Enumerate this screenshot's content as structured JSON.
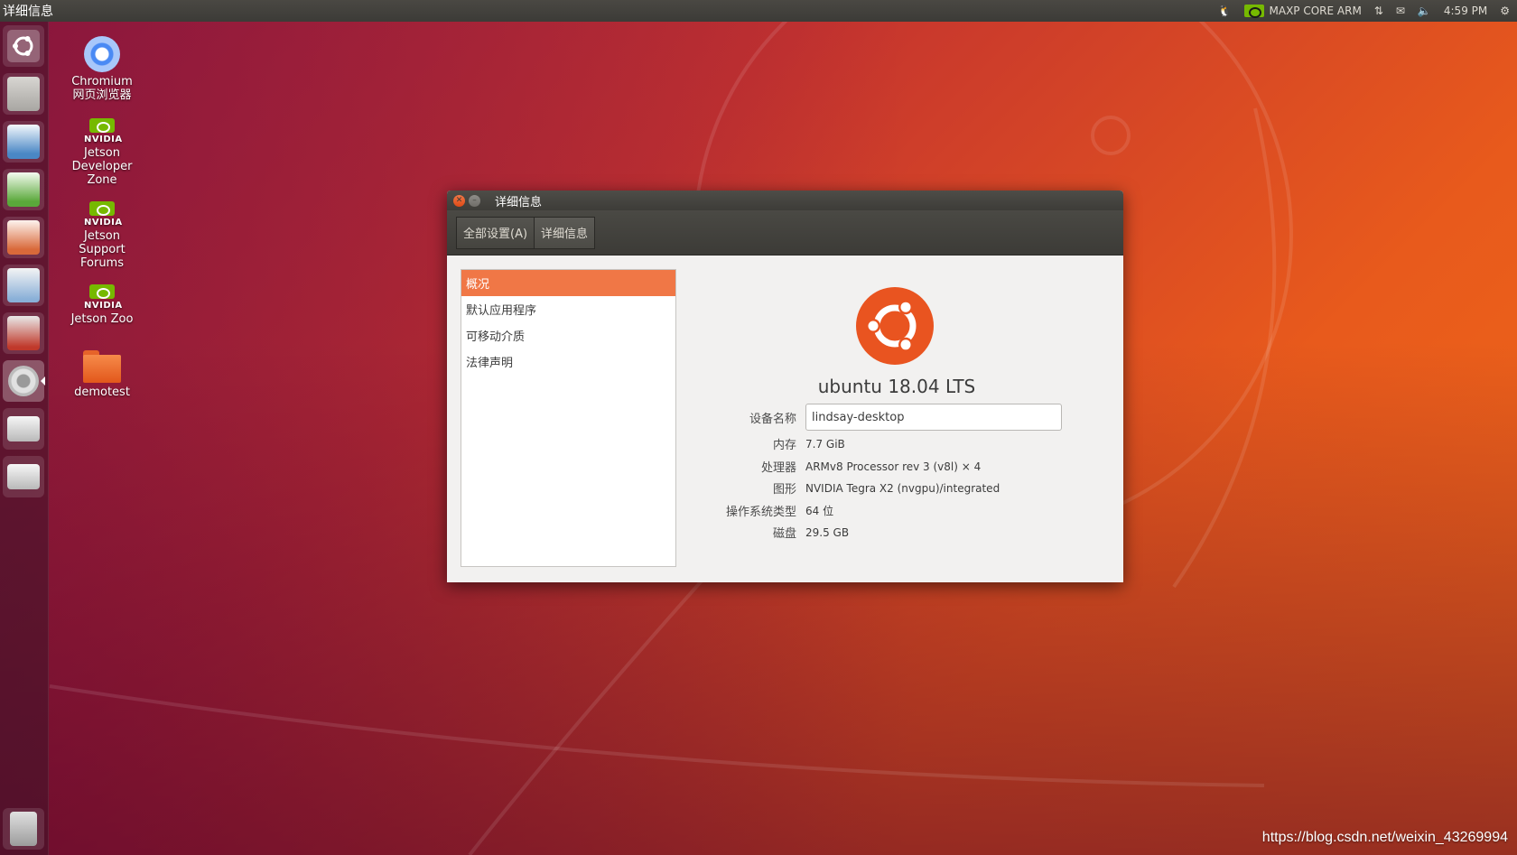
{
  "panel": {
    "app_title": "详细信息",
    "power_mode": "MAXP CORE ARM",
    "clock": "4:59 PM",
    "icons": [
      "nvidia-icon",
      "network-icon",
      "mail-icon",
      "volume-icon",
      "gear-icon"
    ]
  },
  "launcher": {
    "items": [
      "ubuntu-dash",
      "files",
      "writer",
      "calc",
      "impress",
      "software-center",
      "system-tools",
      "system-settings",
      "drive",
      "usb-drive"
    ],
    "trash": "trash"
  },
  "desktop": {
    "chromium": {
      "line1": "Chromium",
      "line2": "网页浏览器"
    },
    "devzone": {
      "brand": "nvidia",
      "line1": "Jetson",
      "line2": "Developer",
      "line3": "Zone"
    },
    "forums": {
      "brand": "nvidia",
      "line1": "Jetson",
      "line2": "Support",
      "line3": "Forums"
    },
    "zoo": {
      "brand": "nvidia",
      "line1": "Jetson Zoo"
    },
    "folder": {
      "label": "demotest"
    }
  },
  "dialog": {
    "title": "详细信息",
    "breadcrumbs": [
      "全部设置(A)",
      "详细信息"
    ],
    "sidebar": [
      "概况",
      "默认应用程序",
      "可移动介质",
      "法律声明"
    ],
    "distro": "ubuntu 18.04 LTS",
    "device_name_label": "设备名称",
    "device_name_value": "lindsay-desktop",
    "rows": [
      {
        "label": "内存",
        "value": "7.7 GiB"
      },
      {
        "label": "处理器",
        "value": "ARMv8 Processor rev 3 (v8l) × 4"
      },
      {
        "label": "图形",
        "value": "NVIDIA Tegra X2 (nvgpu)/integrated"
      },
      {
        "label": "操作系统类型",
        "value": "64 位"
      },
      {
        "label": "磁盘",
        "value": "29.5 GB"
      }
    ]
  },
  "watermark": "https://blog.csdn.net/weixin_43269994",
  "colors": {
    "accent": "#f07746",
    "panel": "#3c3b37",
    "ubuntu_orange": "#e95420"
  }
}
